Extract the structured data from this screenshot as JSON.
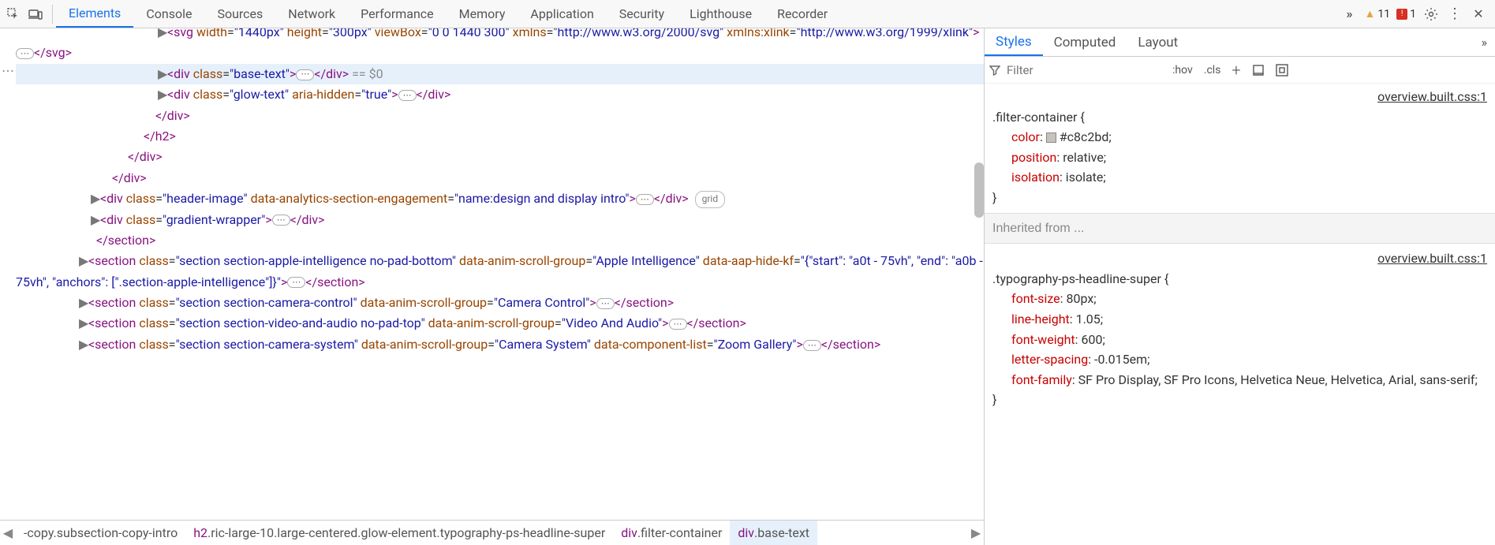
{
  "toolbar": {
    "tabs": [
      "Elements",
      "Console",
      "Sources",
      "Network",
      "Performance",
      "Memory",
      "Application",
      "Security",
      "Lighthouse",
      "Recorder"
    ],
    "activeTab": 0,
    "warnings": "11",
    "errors": "1"
  },
  "dom": {
    "lines": [
      {
        "indent": 180,
        "arrow": "▶",
        "sel": false,
        "html": "<span class='tag'>&lt;svg</span> <span class='attr-n'>width</span>=<span class='attr-v'>\"1440px\"</span> <span class='attr-n'>height</span>=<span class='attr-v'>\"300px\"</span> <span class='attr-n'>viewBox</span>=<span class='attr-v'>\"0 0 1440 300\"</span> <span class='attr-n'>xmlns</span>=<span class='attr-v'>\"http://www.w3.org/2000/svg\"</span> <span class='attr-n'>xmlns:xlink</span>=<span class='attr-v'>\"http://www.w3.org/1999/xlink\"</span><span class='tag'>&gt;</span><span class='expand-btn'>⋯</span><span class='tag'>&lt;/svg&gt;</span>",
        "topCut": true
      },
      {
        "indent": 180,
        "arrow": "▶",
        "sel": true,
        "html": "<span class='tag'>&lt;div</span> <span class='attr-n'>class</span>=<span class='attr-v'>\"base-text\"</span><span class='tag'>&gt;</span><span class='expand-btn'>⋯</span><span class='tag'>&lt;/div&gt;</span> <span class='dim'>== $0</span>"
      },
      {
        "indent": 180,
        "arrow": "▶",
        "sel": false,
        "html": "<span class='tag'>&lt;div</span> <span class='attr-n'>class</span>=<span class='attr-v'>\"glow-text\"</span> <span class='attr-n'>aria-hidden</span>=<span class='attr-v'>\"true\"</span><span class='tag'>&gt;</span><span class='expand-btn'>⋯</span><span class='tag'>&lt;/div&gt;</span>"
      },
      {
        "indent": 165,
        "arrow": "",
        "sel": false,
        "html": "<span class='tag'>&lt;/div&gt;</span>"
      },
      {
        "indent": 150,
        "arrow": "",
        "sel": false,
        "html": "<span class='tag'>&lt;/h2&gt;</span>"
      },
      {
        "indent": 130,
        "arrow": "",
        "sel": false,
        "html": "<span class='tag'>&lt;/div&gt;</span>"
      },
      {
        "indent": 110,
        "arrow": "",
        "sel": false,
        "html": "<span class='tag'>&lt;/div&gt;</span>"
      },
      {
        "indent": 95,
        "arrow": "▶",
        "sel": false,
        "html": "<span class='tag'>&lt;div</span> <span class='attr-n'>class</span>=<span class='attr-v'>\"header-image\"</span> <span class='attr-n'>data-analytics-section-engagement</span>=<span class='attr-v'>\"name:design and display intro\"</span><span class='tag'>&gt;</span><span class='expand-btn'>⋯</span><span class='tag'>&lt;/div&gt;</span> <span class='badge'>grid</span>"
      },
      {
        "indent": 95,
        "arrow": "▶",
        "sel": false,
        "html": "<span class='tag'>&lt;div</span> <span class='attr-n'>class</span>=<span class='attr-v'>\"gradient-wrapper\"</span><span class='tag'>&gt;</span><span class='expand-btn'>⋯</span><span class='tag'>&lt;/div&gt;</span>"
      },
      {
        "indent": 90,
        "arrow": "",
        "sel": false,
        "html": "<span class='tag'>&lt;/section&gt;</span>"
      },
      {
        "indent": 80,
        "arrow": "▶",
        "sel": false,
        "html": "<span class='tag'>&lt;section</span> <span class='attr-n'>class</span>=<span class='attr-v'>\"section section-apple-intelligence no-pad-bottom\"</span> <span class='attr-n'>data-anim-scroll-group</span>=<span class='attr-v'>\"Apple Intelligence\"</span> <span class='attr-n'>data-aap-hide-kf</span>=<span class='attr-v'>\"{&quot;start&quot;: &quot;a0t - 75vh&quot;, &quot;end&quot;: &quot;a0b - 75vh&quot;, &quot;anchors&quot;: [&quot;.section-apple-intelligence&quot;]}\"</span><span class='tag'>&gt;</span><span class='expand-btn'>⋯</span><span class='tag'>&lt;/section&gt;</span>"
      },
      {
        "indent": 80,
        "arrow": "▶",
        "sel": false,
        "html": "<span class='tag'>&lt;section</span> <span class='attr-n'>class</span>=<span class='attr-v'>\"section section-camera-control\"</span> <span class='attr-n'>data-anim-scroll-group</span>=<span class='attr-v'>\"Camera Control\"</span><span class='tag'>&gt;</span><span class='expand-btn'>⋯</span><span class='tag'>&lt;/section&gt;</span>"
      },
      {
        "indent": 80,
        "arrow": "▶",
        "sel": false,
        "html": "<span class='tag'>&lt;section</span> <span class='attr-n'>class</span>=<span class='attr-v'>\"section section-video-and-audio no-pad-top\"</span> <span class='attr-n'>data-anim-scroll-group</span>=<span class='attr-v'>\"Video And Audio\"</span><span class='tag'>&gt;</span><span class='expand-btn'>⋯</span><span class='tag'>&lt;/section&gt;</span>"
      },
      {
        "indent": 80,
        "arrow": "▶",
        "sel": false,
        "html": "<span class='tag'>&lt;section</span> <span class='attr-n'>class</span>=<span class='attr-v'>\"section section-camera-system\"</span> <span class='attr-n'>data-anim-scroll-group</span>=<span class='attr-v'>\"Camera System\"</span> <span class='attr-n'>data-component-list</span>=<span class='attr-v'>\"Zoom Gallery\"</span><span class='tag'>&gt;</span><span class='expand-btn'>⋯</span><span class='tag'>&lt;/section&gt;</span>"
      }
    ]
  },
  "crumbs": {
    "items": [
      {
        "text": "-copy.subsection-copy-intro",
        "active": false,
        "el": "",
        "cls": "-copy.subsection-copy-intro"
      },
      {
        "text": "h2.ric-large-10.large-centered.glow-element.typography-ps-headline-super",
        "active": false,
        "el": "h2",
        "cls": ".ric-large-10.large-centered.glow-element.typography-ps-headline-super"
      },
      {
        "text": "div.filter-container",
        "active": false,
        "el": "div",
        "cls": ".filter-container"
      },
      {
        "text": "div.base-text",
        "active": true,
        "el": "div",
        "cls": ".base-text"
      }
    ]
  },
  "stylesTabs": {
    "items": [
      "Styles",
      "Computed",
      "Layout"
    ],
    "active": 0
  },
  "stylesToolbar": {
    "filterPlaceholder": "Filter",
    "hov": ":hov",
    "cls": ".cls"
  },
  "rules": [
    {
      "src": "overview.built.css:1",
      "selector": ".filter-container",
      "props": [
        {
          "n": "color",
          "v": "#c8c2bd",
          "swatch": "#c8c2bd"
        },
        {
          "n": "position",
          "v": "relative"
        },
        {
          "n": "isolation",
          "v": "isolate"
        }
      ]
    }
  ],
  "inherited": "Inherited from ...",
  "rules2": [
    {
      "src": "overview.built.css:1",
      "selector": ".typography-ps-headline-super",
      "props": [
        {
          "n": "font-size",
          "v": "80px"
        },
        {
          "n": "line-height",
          "v": "1.05"
        },
        {
          "n": "font-weight",
          "v": "600"
        },
        {
          "n": "letter-spacing",
          "v": "-0.015em"
        },
        {
          "n": "font-family",
          "v": "SF Pro Display, SF Pro Icons, Helvetica Neue, Helvetica, Arial, sans-serif",
          "wrap": true
        }
      ]
    }
  ]
}
